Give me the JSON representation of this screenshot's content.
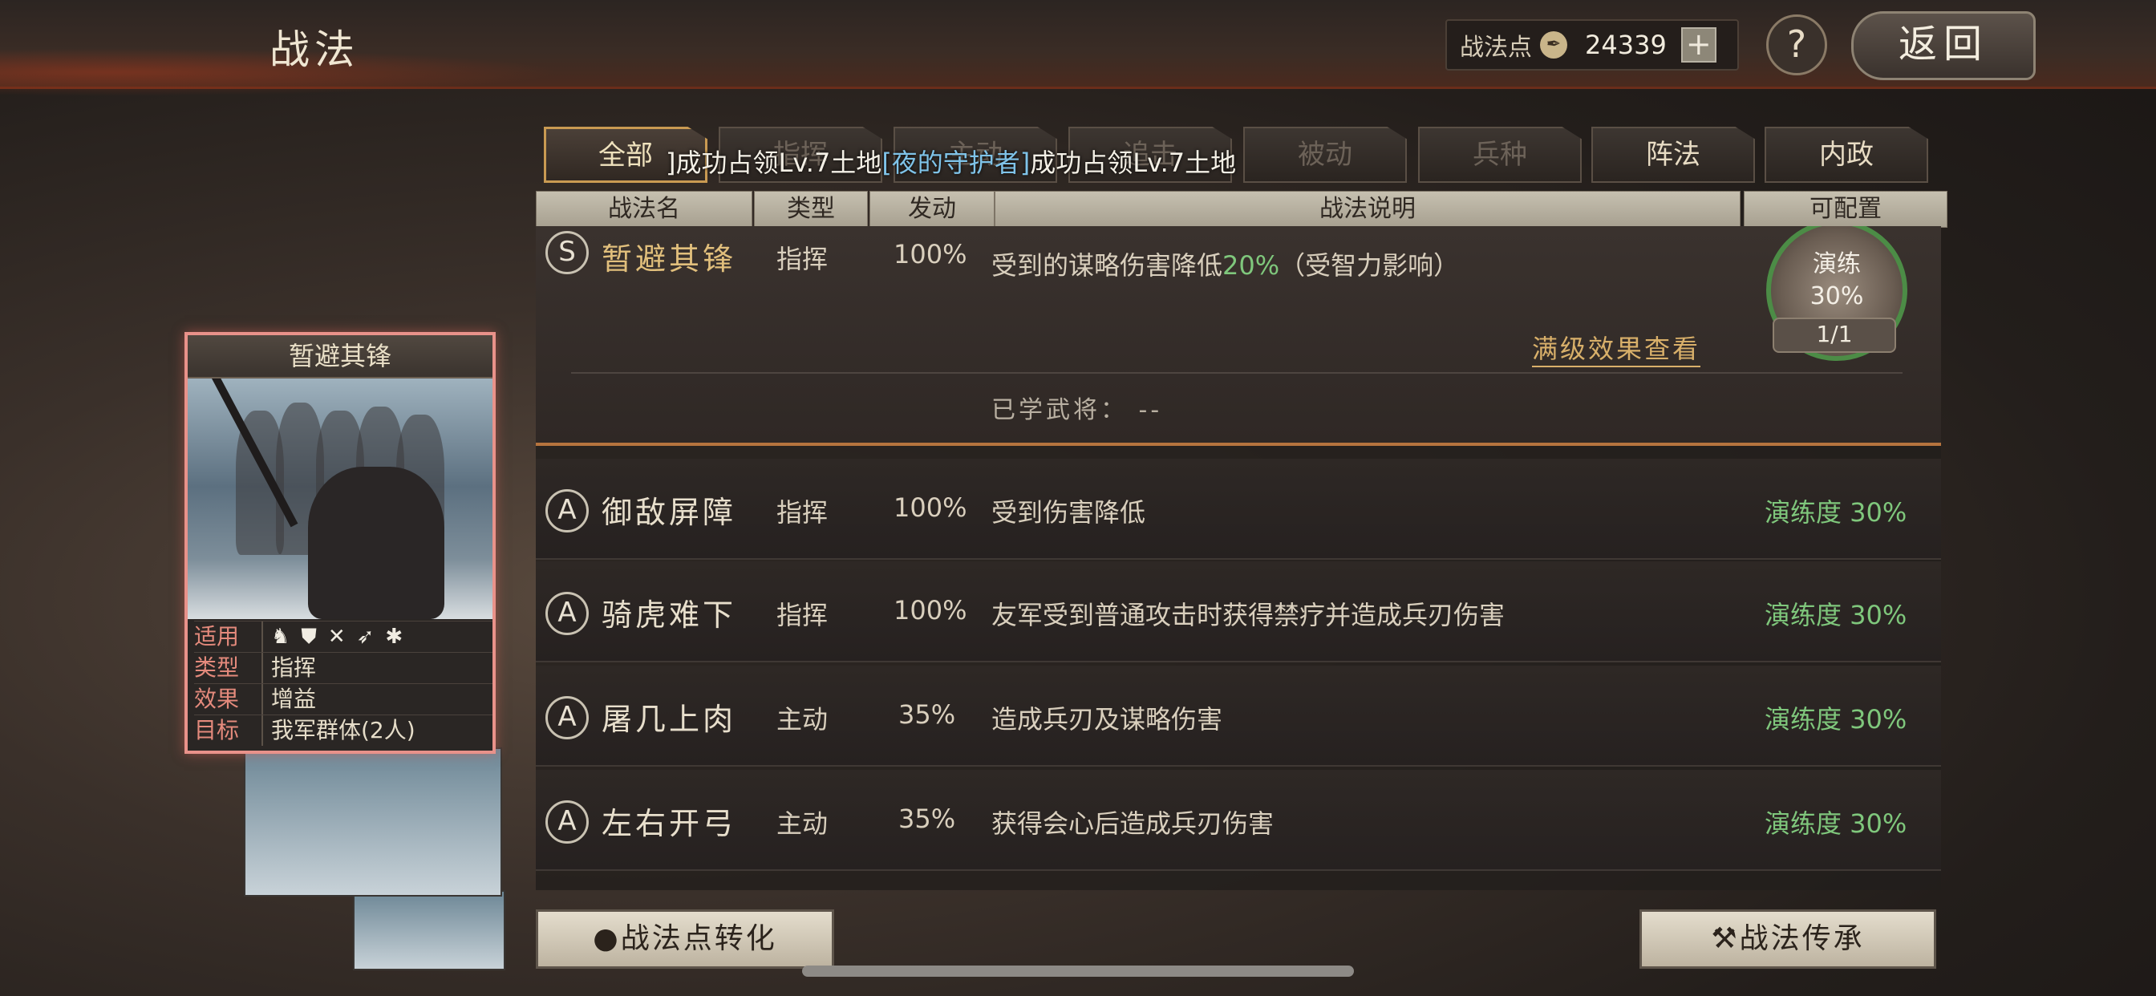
{
  "header": {
    "title": "战法",
    "points_label": "战法点",
    "points_icon": "feather-coin-icon",
    "points_value": "24339",
    "plus_label": "+",
    "help_label": "?",
    "back_label": "返回"
  },
  "card": {
    "name": "暂避其锋",
    "apply_label": "适用",
    "apply_icons": [
      "♞",
      "⛊",
      "✕",
      "➶",
      "✱"
    ],
    "type_label": "类型",
    "type_value": "指挥",
    "effect_label": "效果",
    "effect_value": "增益",
    "target_label": "目标",
    "target_value": "我军群体(2人)"
  },
  "tabs": [
    {
      "label": "全部",
      "active": true
    },
    {
      "label": "指挥"
    },
    {
      "label": "主动"
    },
    {
      "label": "追击"
    },
    {
      "label": "被动"
    },
    {
      "label": "兵种"
    },
    {
      "label": "阵法"
    },
    {
      "label": "内政"
    }
  ],
  "marquee": {
    "part1": "]成功占领Lv.7土地",
    "highlight": "[夜的守护者]",
    "part2": "成功占领Lv.7土地"
  },
  "table_header": {
    "name": "战法名",
    "type": "类型",
    "trigger": "发动",
    "description": "战法说明",
    "configurable": "可配置"
  },
  "expanded": {
    "grade": "S",
    "name": "暂避其锋",
    "type": "指挥",
    "trigger": "100%",
    "desc_prefix": "受到的谋略伤害降低",
    "desc_value": "20%",
    "desc_suffix": "（受智力影响）",
    "proficiency_label": "演练",
    "proficiency_value": "30%",
    "count": "1/1",
    "full_effect_link": "满级效果查看",
    "learned_label": "已学武将：",
    "learned_value": "--"
  },
  "rows": [
    {
      "grade": "A",
      "name": "御敌屏障",
      "type": "指挥",
      "trigger": "100%",
      "desc": "受到伤害降低",
      "prof": "演练度 30%"
    },
    {
      "grade": "A",
      "name": "骑虎难下",
      "type": "指挥",
      "trigger": "100%",
      "desc": "友军受到普通攻击时获得禁疗并造成兵刃伤害",
      "prof": "演练度 30%"
    },
    {
      "grade": "A",
      "name": "屠几上肉",
      "type": "主动",
      "trigger": "35%",
      "desc": "造成兵刃及谋略伤害",
      "prof": "演练度 30%"
    },
    {
      "grade": "A",
      "name": "左右开弓",
      "type": "主动",
      "trigger": "35%",
      "desc": "获得会心后造成兵刃伤害",
      "prof": "演练度 30%"
    }
  ],
  "buttons": {
    "convert_icon": "drop-icon",
    "convert_label": "战法点转化",
    "inherit_icon": "hammer-icon",
    "inherit_label": "战法传承"
  }
}
